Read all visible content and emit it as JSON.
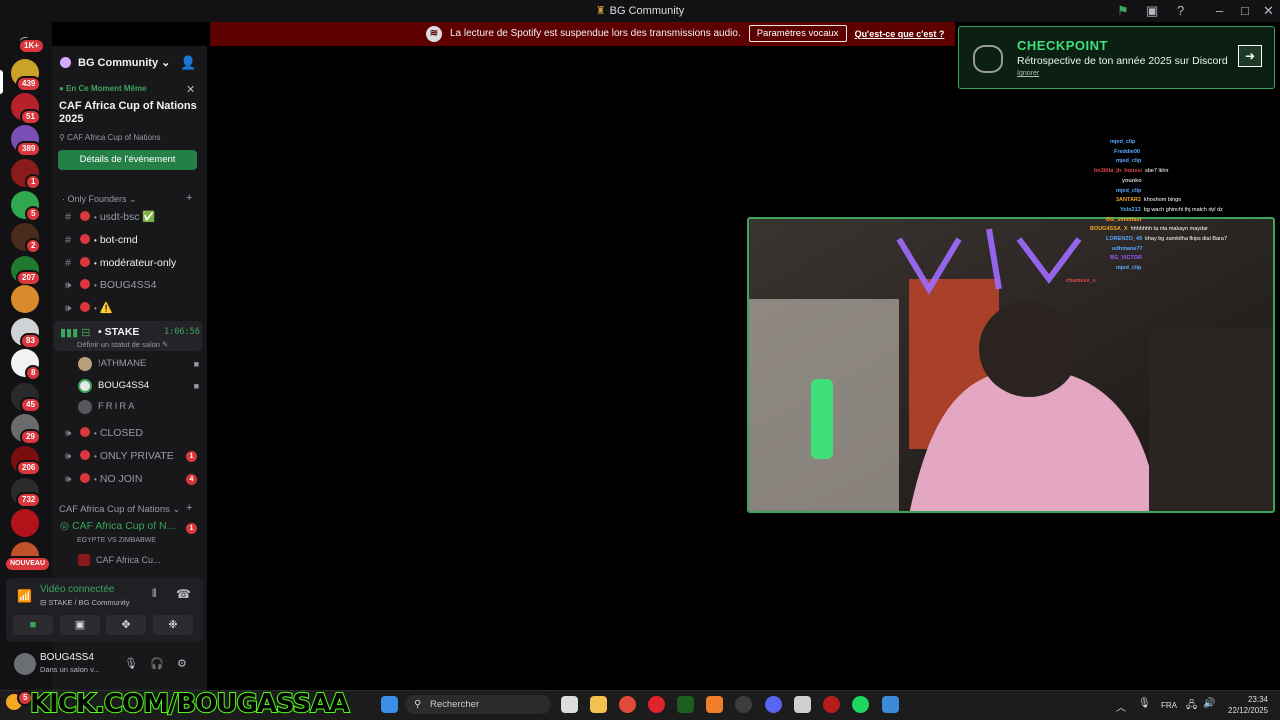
{
  "window": {
    "title": "BG Community"
  },
  "banner": {
    "text": "La lecture de Spotify est suspendue lors des transmissions audio.",
    "button": "Paramètres vocaux",
    "link": "Qu'est-ce que c'est ?"
  },
  "servers": {
    "badges": [
      "1K+",
      "439",
      "51",
      "389",
      "1",
      "5",
      "2",
      "207",
      "83",
      "8",
      "45",
      "29",
      "206",
      "732",
      "NOUVEAU"
    ]
  },
  "guild": {
    "name": "BG Community"
  },
  "event": {
    "live_label": "En Ce Moment Même",
    "title": "CAF Africa Cup of Nations 2025",
    "location": "CAF Africa Cup of Nations",
    "button": "Détails de l'événement"
  },
  "categories": {
    "founders": "Only Founders",
    "caf": "CAF Africa Cup of Nations"
  },
  "channels": {
    "usdt": "usdt-bsc ✅",
    "botcmd": "bot-cmd",
    "moderateur": "modérateur-only",
    "boug4ss4": "BOUG4SS4",
    "warn": "⚠️",
    "stake": "STAKE",
    "stake_time": "1:06:56",
    "stake_status": "Définir un statut de salon",
    "closed": "CLOSED",
    "only_private": "ONLY PRIVATE",
    "only_private_count": "1",
    "no_join": "NO JOIN",
    "no_join_count": "4",
    "caf_voice": "CAF Africa Cup of N...",
    "caf_voice_count": "1",
    "caf_sub": "EGYPTE VS ZIMBABWE",
    "caf_stage": "CAF Africa Cu..."
  },
  "members": [
    "!ATHMANE",
    "BOUG4SS4",
    "FRIRA"
  ],
  "voice": {
    "title": "Vidéo connectée",
    "subtitle": "STAKE / BG Community"
  },
  "user": {
    "name": "BOUG4SS4",
    "status": "Dans un salon v..."
  },
  "quest": {
    "title": "CHECKPOINT",
    "subtitle": "Rétrospective de ton année 2025 sur Discord",
    "ignore": "Ignorer"
  },
  "stream_chat": [
    {
      "user": "mjed_clip",
      "text": "",
      "color": "#5aa9ff"
    },
    {
      "user": "Freddie00",
      "text": "",
      "color": "#5aa9ff"
    },
    {
      "user": "mjed_clip",
      "text": "",
      "color": "#5aa9ff"
    },
    {
      "user": "bn3iltla_jb_houssi",
      "text": "sbe7 lkhir",
      "color": "#e04848"
    },
    {
      "user": "younko",
      "text": "",
      "color": "#cfcfcf"
    },
    {
      "user": "mjed_clip",
      "text": "",
      "color": "#5aa9ff"
    },
    {
      "user": "3ANTAR2",
      "text": "khoshom bingo",
      "color": "#f5a623"
    },
    {
      "user": "Yolo213",
      "text": "bg wach ghinchi thj match dyl dz",
      "color": "#5aa9ff"
    },
    {
      "user": "BG_simolfasi",
      "text": "",
      "color": "#f5a623"
    },
    {
      "user": "BOUG4SSA_X",
      "text": "hhhhhhh ta nta makayn maydar",
      "color": "#f5a623"
    },
    {
      "user": "LORENZO_49",
      "text": "khay bg zamkitha fkips dial Bara7",
      "color": "#5aa9ff"
    },
    {
      "user": "udhmane77",
      "text": "",
      "color": "#5aa9ff"
    },
    {
      "user": "BG_VICTOR",
      "text": "",
      "color": "#9b59ff"
    },
    {
      "user": "mjed_clip",
      "text": "",
      "color": "#5aa9ff"
    },
    {
      "user": "chamsss_s",
      "text": "",
      "color": "#e04848"
    }
  ],
  "taskbar": {
    "kick": "KICK.COM/BOUGASSAA",
    "search": "Rechercher",
    "lang": "FRA",
    "time": "23:34",
    "date": "22/12/2025"
  },
  "colors": {
    "accent_green": "#3ba55c",
    "danger": "#da373c",
    "kick_green": "#53fc18"
  }
}
